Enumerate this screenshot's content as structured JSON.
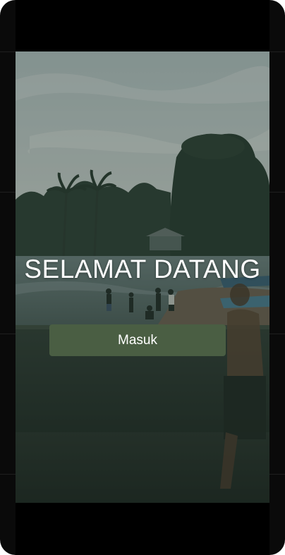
{
  "welcome": {
    "title": "SELAMAT DATANG"
  },
  "actions": {
    "login_label": "Masuk"
  },
  "theme": {
    "accent": "#4a5e43",
    "overlay": "#1f2d25",
    "text": "#ffffff"
  },
  "background": {
    "scene": "beach-landscape-photo"
  }
}
